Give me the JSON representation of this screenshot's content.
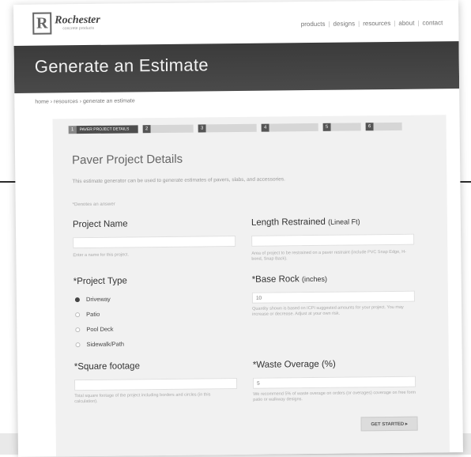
{
  "brand": {
    "name": "Rochester",
    "tagline": "concrete products",
    "mark": "R"
  },
  "nav": [
    "products",
    "designs",
    "resources",
    "about",
    "contact"
  ],
  "hero": {
    "title": "Generate an Estimate"
  },
  "breadcrumb": "home › resources › generate an estimate",
  "steps": [
    {
      "num": "1",
      "label": "PAVER PROJECT DETAILS",
      "active": true
    },
    {
      "num": "2",
      "label": "",
      "active": false
    },
    {
      "num": "3",
      "label": "",
      "active": false
    },
    {
      "num": "4",
      "label": "",
      "active": false
    },
    {
      "num": "5",
      "label": "",
      "active": false
    },
    {
      "num": "6",
      "label": "",
      "active": false
    }
  ],
  "form": {
    "section_title": "Paver Project Details",
    "intro": "This estimate generator can be used to generate estimates of pavers, slabs, and accessories.",
    "required_note": "*Denotes an answer",
    "project_name": {
      "label": "Project Name",
      "value": "",
      "help": "Enter a name for this project."
    },
    "length_restrained": {
      "label": "Length Restrained",
      "unit": "(Lineal Ft)",
      "value": "",
      "help": "Area of project to be restrained on a paver restraint (include PVC Snap Edge, H-bond, Snap Back)."
    },
    "project_type": {
      "label": "*Project Type",
      "options": [
        "Driveway",
        "Patio",
        "Pool Deck",
        "Sidewalk/Path"
      ],
      "selected": "Driveway"
    },
    "base_rock": {
      "label": "*Base Rock",
      "unit": "(inches)",
      "value": "10",
      "help": "Quantity shown is based on ICPI suggested amounts for your project. You may increase or decrease. Adjust at your own risk."
    },
    "square_footage": {
      "label": "*Square footage",
      "value": "",
      "help": "Total square footage of the project including borders and circles (in this calculation)."
    },
    "waste_overage": {
      "label": "*Waste Overage (%)",
      "value": "5",
      "help": "We recommend 5% of waste overage on orders (or overages) coverage on free form patio or walkway designs."
    },
    "submit_label": "GET STARTED ▸"
  }
}
